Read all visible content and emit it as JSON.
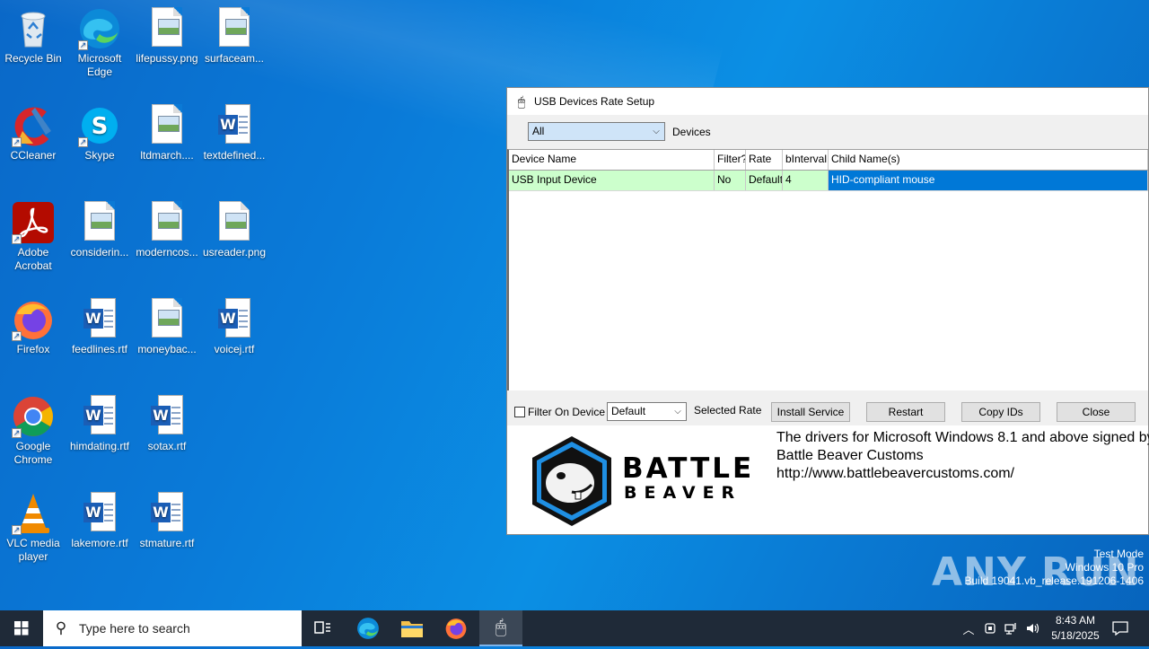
{
  "desktop": {
    "icons": [
      {
        "label": "Recycle Bin",
        "icon": "recycle-bin-icon"
      },
      {
        "label": "Microsoft Edge",
        "icon": "edge-icon"
      },
      {
        "label": "lifepussy.png",
        "icon": "image-file-icon"
      },
      {
        "label": "surfaceam...",
        "icon": "image-file-icon"
      },
      {
        "label": "CCleaner",
        "icon": "ccleaner-icon"
      },
      {
        "label": "Skype",
        "icon": "skype-icon"
      },
      {
        "label": "ltdmarch....",
        "icon": "image-file-icon"
      },
      {
        "label": "textdefined...",
        "icon": "word-doc-icon"
      },
      {
        "label": "Adobe Acrobat",
        "icon": "acrobat-icon"
      },
      {
        "label": "considerin...",
        "icon": "image-file-icon"
      },
      {
        "label": "moderncos...",
        "icon": "image-file-icon"
      },
      {
        "label": "usreader.png",
        "icon": "image-file-icon"
      },
      {
        "label": "Firefox",
        "icon": "firefox-icon"
      },
      {
        "label": "feedlines.rtf",
        "icon": "word-doc-icon"
      },
      {
        "label": "moneybac...",
        "icon": "image-file-icon"
      },
      {
        "label": "voicej.rtf",
        "icon": "word-doc-icon"
      },
      {
        "label": "Google Chrome",
        "icon": "chrome-icon"
      },
      {
        "label": "himdating.rtf",
        "icon": "word-doc-icon"
      },
      {
        "label": "sotax.rtf",
        "icon": "word-doc-icon"
      },
      {
        "label": "VLC media player",
        "icon": "vlc-icon"
      },
      {
        "label": "lakemore.rtf",
        "icon": "word-doc-icon"
      },
      {
        "label": "stmature.rtf",
        "icon": "word-doc-icon"
      }
    ]
  },
  "window": {
    "title": "USB Devices Rate Setup",
    "filter_select": "All",
    "devices_label": "Devices",
    "columns": [
      "Device Name",
      "Filter?",
      "Rate",
      "bInterval",
      "Child Name(s)"
    ],
    "rows": [
      {
        "device": "USB Input Device",
        "filter": "No",
        "rate": "Default",
        "binterval": "4",
        "child": "HID-compliant mouse"
      }
    ],
    "filter_on_device_label": "Filter On Device",
    "rate_select": "Default",
    "selected_rate_label": "Selected Rate",
    "buttons": {
      "install": "Install Service",
      "restart": "Restart",
      "copy": "Copy IDs",
      "close": "Close"
    },
    "brand_line1": "BATTLE",
    "brand_line2": "BEAVER",
    "info_line1": "The drivers for Microsoft Windows 8.1 and above signed by",
    "info_line2": "Battle Beaver Customs",
    "info_line3": "http://www.battlebeavercustoms.com/"
  },
  "watermark": {
    "logo_text": "ANY RUN",
    "line1": "Test Mode",
    "line2": "Windows 10 Pro",
    "line3": "Build 19041.vb_release.191206-1406"
  },
  "taskbar": {
    "search_placeholder": "Type here to search",
    "time": "8:43 AM",
    "date": "5/18/2025"
  },
  "colors": {
    "selection": "#0078d7",
    "row_highlight": "#ccffcc",
    "taskbar": "#1f2a38"
  }
}
